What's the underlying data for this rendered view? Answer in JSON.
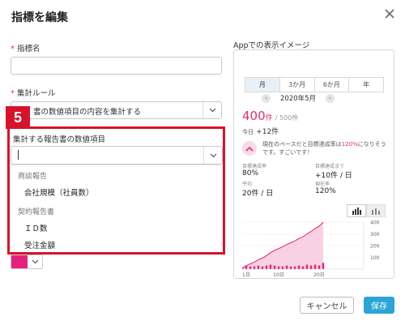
{
  "dialog": {
    "title": "指標を編集"
  },
  "form": {
    "required_mark": "*",
    "name_label": "指標名",
    "name_value": "",
    "rule_label": "集計ルール",
    "rule_value": "書の数値項目の内容を集計する",
    "field_label": "集計する報告書の数値項目",
    "field_value": ""
  },
  "callout": {
    "number": "5"
  },
  "dropdown": {
    "group1": "商談報告",
    "item1": "会社規模（社員数）",
    "group2": "契約報告書",
    "item2": "ＩＤ数",
    "item3": "受注金額"
  },
  "color_picker": {
    "value": "#e6217a"
  },
  "preview": {
    "title": "Appでの表示イメージ",
    "tabs": [
      "月",
      "3か月",
      "6か月",
      "年"
    ],
    "prev": "‹",
    "next": "›",
    "period": "2020年5月",
    "value_big": "400",
    "value_unit": "件",
    "value_target": "/ 500件",
    "today_label": "今日",
    "today_value": "+12件",
    "message_pre": "現在のペースだと目標達成率は",
    "message_pct": "120%",
    "message_post": "になりそうです。すごいです！",
    "stats": [
      {
        "label": "目標達成率",
        "value": "80%"
      },
      {
        "label": "目標達成まで",
        "value": "+10件 / 日"
      },
      {
        "label": "平均",
        "value": "20件 / 日"
      },
      {
        "label": "現在率",
        "value": "120%"
      }
    ],
    "y_ticks": [
      "400",
      "300",
      "200",
      "100"
    ],
    "x_ticks": [
      "1日",
      "10日",
      "20日"
    ]
  },
  "chart_data": {
    "type": "area",
    "cumulative": [
      10,
      30,
      45,
      60,
      80,
      95,
      115,
      140,
      160,
      175,
      190,
      210,
      225,
      240,
      260,
      275,
      300,
      320,
      345,
      365,
      400
    ],
    "daily": [
      10,
      20,
      15,
      15,
      20,
      15,
      20,
      25,
      20,
      15,
      15,
      20,
      15,
      15,
      20,
      15,
      25,
      20,
      25,
      20,
      35
    ],
    "ylim": [
      0,
      400
    ],
    "colors": {
      "line": "#e6217a",
      "fill": "#f8c6dd"
    }
  },
  "buttons": {
    "cancel": "キャンセル",
    "save": "保存"
  }
}
